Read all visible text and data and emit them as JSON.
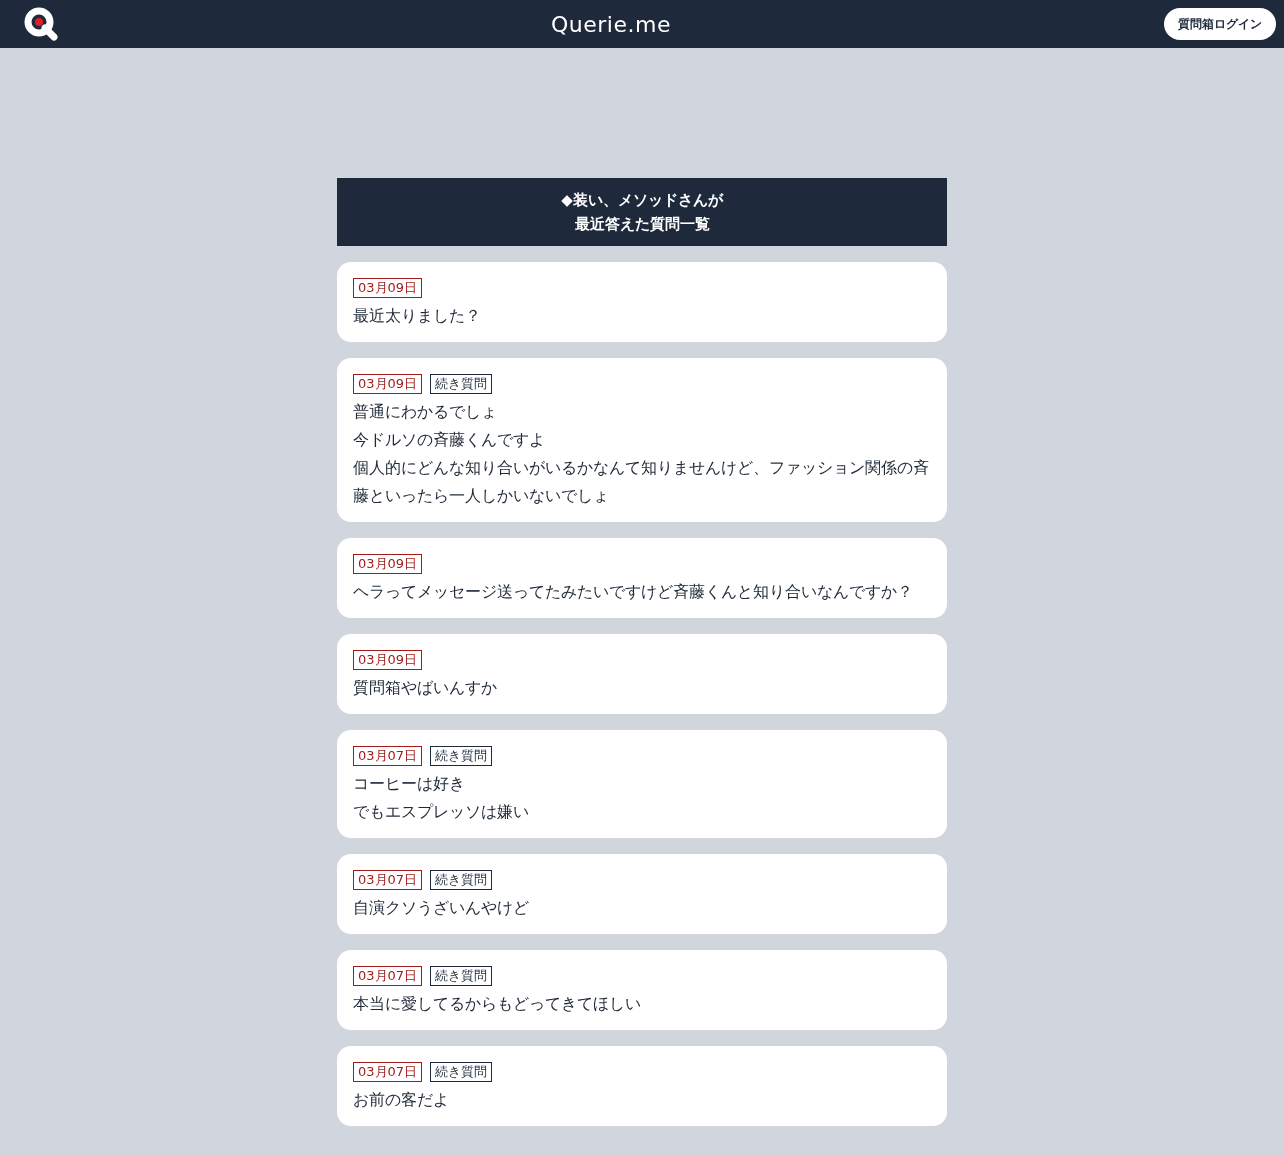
{
  "header": {
    "site_title": "Querie.me",
    "login_button": "質問箱ログイン"
  },
  "list_heading": {
    "lines": [
      "◆装い、メソッドさんが",
      "最近答えた質問一覧"
    ]
  },
  "questions": [
    {
      "tags": [
        {
          "kind": "date",
          "text": "03月09日"
        }
      ],
      "lines": [
        "最近太りました？"
      ]
    },
    {
      "tags": [
        {
          "kind": "date",
          "text": "03月09日"
        },
        {
          "kind": "followup",
          "text": "続き質問"
        }
      ],
      "lines": [
        "普通にわかるでしょ",
        "今ドルソの斉藤くんですよ",
        "個人的にどんな知り合いがいるかなんて知りませんけど、ファッション関係の斉藤といったら一人しかいないでしょ"
      ]
    },
    {
      "tags": [
        {
          "kind": "date",
          "text": "03月09日"
        }
      ],
      "lines": [
        "ヘラってメッセージ送ってたみたいですけど斉藤くんと知り合いなんですか？"
      ]
    },
    {
      "tags": [
        {
          "kind": "date",
          "text": "03月09日"
        }
      ],
      "lines": [
        "質問箱やばいんすか"
      ]
    },
    {
      "tags": [
        {
          "kind": "date",
          "text": "03月07日"
        },
        {
          "kind": "followup",
          "text": "続き質問"
        }
      ],
      "lines": [
        "コーヒーは好き",
        "でもエスプレッソは嫌い"
      ]
    },
    {
      "tags": [
        {
          "kind": "date",
          "text": "03月07日"
        },
        {
          "kind": "followup",
          "text": "続き質問"
        }
      ],
      "lines": [
        "自演クソうざいんやけど"
      ]
    },
    {
      "tags": [
        {
          "kind": "date",
          "text": "03月07日"
        },
        {
          "kind": "followup",
          "text": "続き質問"
        }
      ],
      "lines": [
        "本当に愛してるからもどってきてほしい"
      ]
    },
    {
      "tags": [
        {
          "kind": "date",
          "text": "03月07日"
        },
        {
          "kind": "followup",
          "text": "続き質問"
        }
      ],
      "lines": [
        "お前の客だよ"
      ]
    }
  ]
}
